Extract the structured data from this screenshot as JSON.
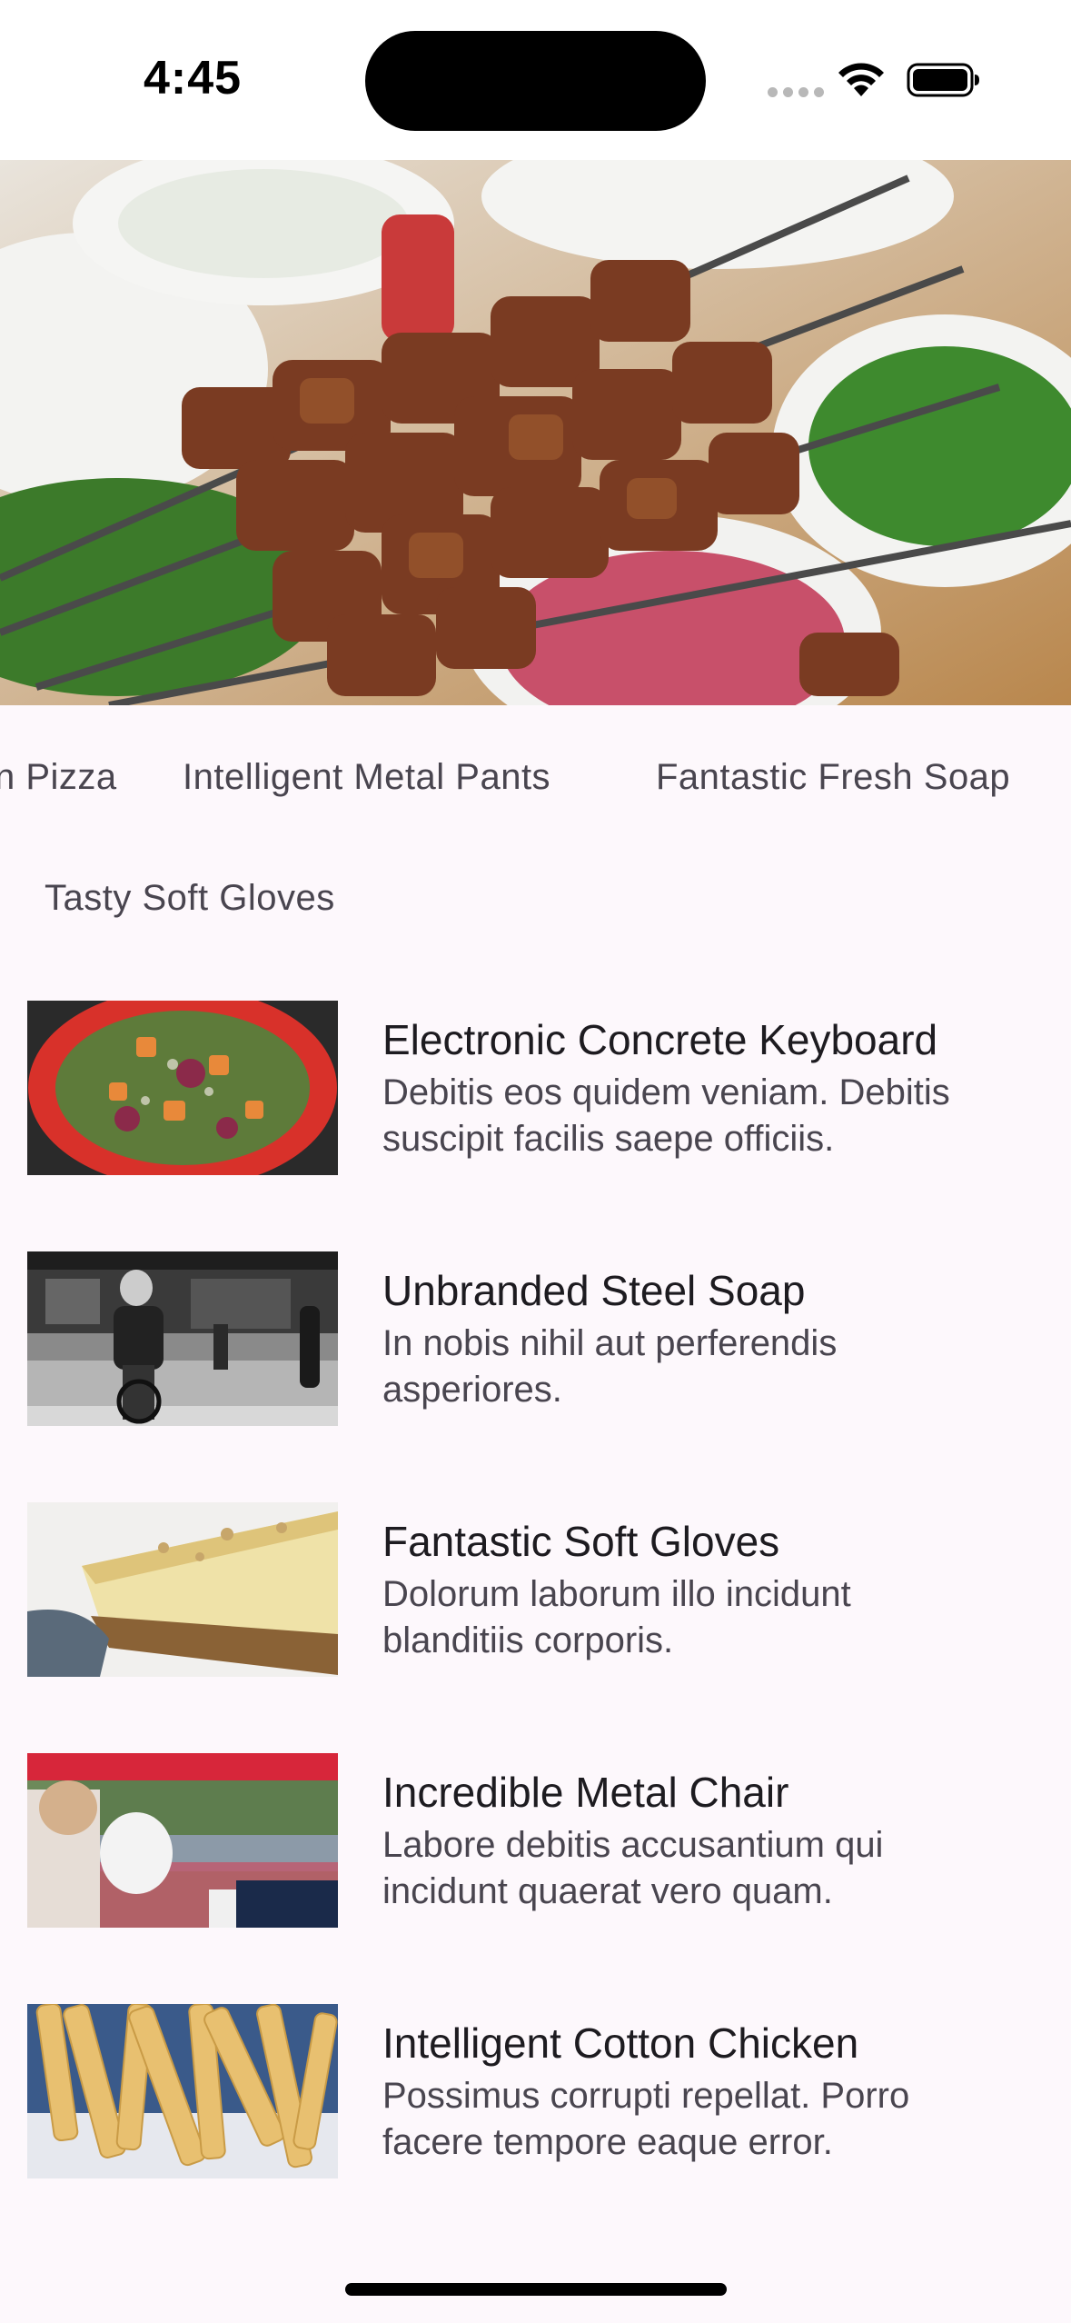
{
  "status_bar": {
    "time": "4:45",
    "icons": [
      "cellular-signal-icon",
      "wifi-icon",
      "battery-icon"
    ]
  },
  "hero": {
    "image": "grilled-meat-skewers-photo"
  },
  "categories": [
    {
      "label": "n Pizza"
    },
    {
      "label": "Intelligent Metal Pants"
    },
    {
      "label": "Fantastic Fresh Soap"
    }
  ],
  "section": {
    "title": "Tasty Soft Gloves"
  },
  "items": [
    {
      "title": "Electronic Concrete Keyboard",
      "description": "Debitis eos quidem veniam. Debitis suscipit facilis saepe officiis.",
      "image": "salad-bowl-photo"
    },
    {
      "title": "Unbranded Steel Soap",
      "description": "In nobis nihil aut perferendis asperiores.",
      "image": "street-cyclist-photo"
    },
    {
      "title": "Fantastic Soft Gloves",
      "description": "Dolorum laborum illo incidunt blanditiis corporis.",
      "image": "cheesecake-slice-photo"
    },
    {
      "title": "Incredible Metal Chair",
      "description": "Labore debitis accusantium qui incidunt quaerat vero quam.",
      "image": "outdoor-market-photo"
    },
    {
      "title": "Intelligent Cotton Chicken",
      "description": "Possimus corrupti repellat. Porro facere tempore eaque error.",
      "image": "french-fries-photo"
    }
  ],
  "colors": {
    "background": "#fdf8fc",
    "text_primary": "#1d1b20",
    "text_secondary": "#49454f"
  }
}
